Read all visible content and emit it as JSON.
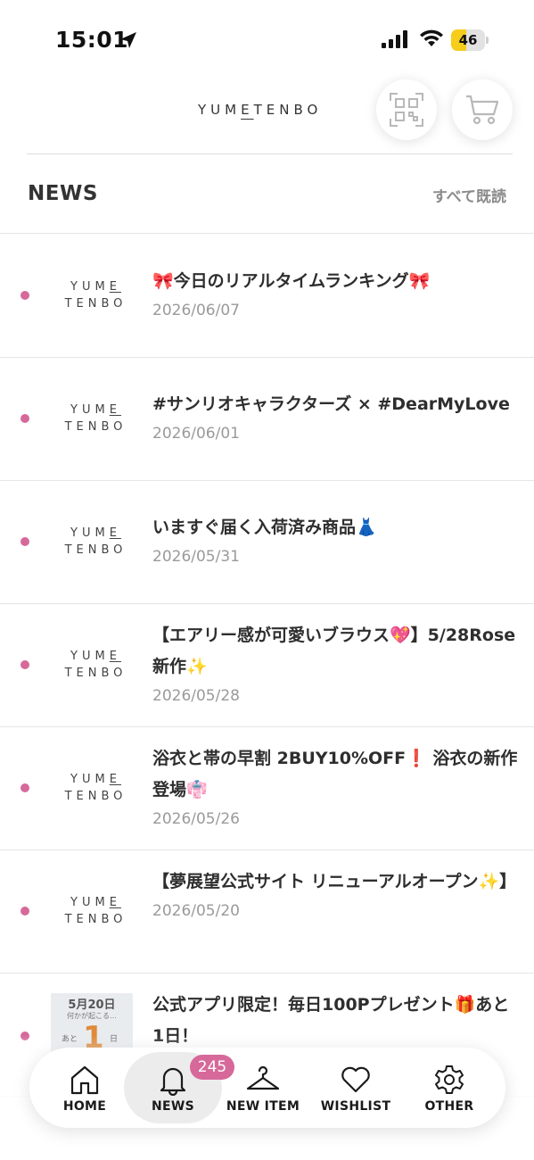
{
  "status_bar": {
    "time": "15:01",
    "battery": "46",
    "battery_level_percent": 46,
    "battery_color": "#f5cd1a"
  },
  "header": {
    "logo_pre": "YUM",
    "logo_under": "E",
    "logo_post": "TENBO",
    "qr_icon": "qr-code-icon",
    "cart_icon": "cart-icon"
  },
  "news": {
    "title": "NEWS",
    "mark_all_read": "すべて既読",
    "unread_dot_color": "#d6699a",
    "items": [
      {
        "title": "🎀今日のリアルタイムランキング🎀",
        "date": "2026/06/07",
        "thumb": {
          "l1a": "YUM",
          "l1b": "E",
          "l2": "TENBO"
        }
      },
      {
        "title": "#サンリオキャラクターズ × #DearMyLove",
        "date": "2026/06/01",
        "thumb": {
          "l1a": "YUM",
          "l1b": "E",
          "l2": "TENBO"
        }
      },
      {
        "title": "いますぐ届く入荷済み商品👗",
        "date": "2026/05/31",
        "thumb": {
          "l1a": "YUM",
          "l1b": "E",
          "l2": "TENBO"
        }
      },
      {
        "title": "【エアリー感が可愛いブラウス💖】5/28Rose 新作✨",
        "date": "2026/05/28",
        "thumb": {
          "l1a": "YUM",
          "l1b": "E",
          "l2": "TENBO"
        }
      },
      {
        "title": "浴衣と帯の早割 2BUY10%OFF❗ 浴衣の新作登場👘",
        "date": "2026/05/26",
        "thumb": {
          "l1a": "YUM",
          "l1b": "E",
          "l2": "TENBO"
        }
      },
      {
        "title": "【夢展望公式サイト リニューアルオープン✨】",
        "date": "2026/05/20",
        "thumb": {
          "l1a": "YUM",
          "l1b": "E",
          "l2": "TENBO"
        }
      },
      {
        "title": "公式アプリ限定！毎日100Pプレゼント🎁あと1日！",
        "date": "",
        "promo": {
          "date": "5月20日",
          "sub": "何かが起こる…",
          "ato": "あと",
          "num": "1",
          "nichi": "日"
        }
      }
    ]
  },
  "tab_bar": {
    "badge": "245",
    "badge_color": "#d6699a",
    "tabs": [
      {
        "label": "HOME",
        "icon": "home-icon"
      },
      {
        "label": "NEWS",
        "icon": "bell-icon"
      },
      {
        "label": "NEW ITEM",
        "icon": "hanger-icon"
      },
      {
        "label": "WISHLIST",
        "icon": "heart-icon"
      },
      {
        "label": "OTHER",
        "icon": "gear-icon"
      }
    ]
  }
}
